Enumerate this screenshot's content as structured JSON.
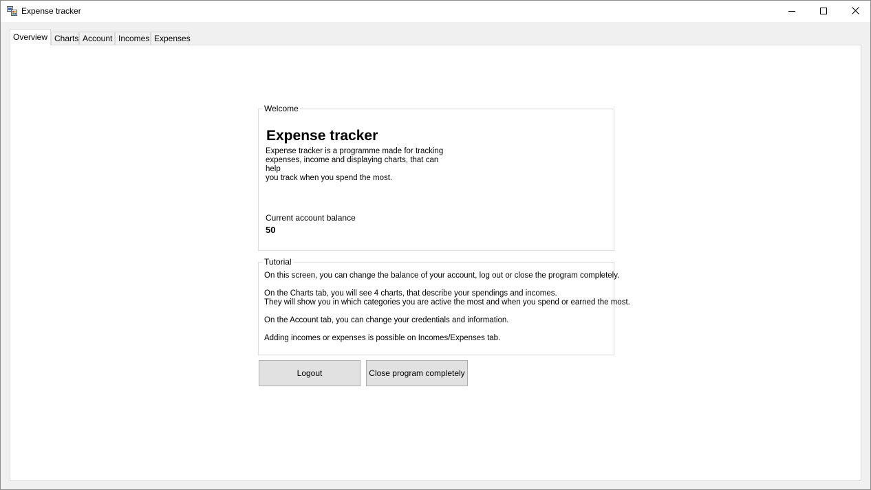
{
  "window": {
    "title": "Expense tracker",
    "icons": {
      "app": "app-icon",
      "minimize": "minimize-icon",
      "maximize": "maximize-icon",
      "close": "close-icon"
    }
  },
  "tabs": [
    {
      "label": "Overview",
      "active": true
    },
    {
      "label": "Charts",
      "active": false
    },
    {
      "label": "Account",
      "active": false
    },
    {
      "label": "Incomes",
      "active": false
    },
    {
      "label": "Expenses",
      "active": false
    }
  ],
  "welcome": {
    "legend": "Welcome",
    "title": "Expense tracker",
    "description_lines": [
      "Expense tracker is a programme made for tracking",
      "expenses, income and displaying charts, that can help",
      "you track when you spend the most."
    ],
    "balance_label": "Current account balance",
    "balance_value": "50"
  },
  "tutorial": {
    "legend": "Tutorial",
    "lines": [
      "On this screen, you can change the balance of your account, log out or close the program completely.",
      "On the Charts tab, you will see 4 charts, that describe your spendings and incomes.",
      "They will show you in which categories you are active the most and when you spend or earned the most.",
      "On the Account tab, you can change your credentials and information.",
      "Adding incomes or expenses is possible on Incomes/Expenses tab."
    ]
  },
  "buttons": {
    "logout": "Logout",
    "close_program": "Close program completely"
  }
}
